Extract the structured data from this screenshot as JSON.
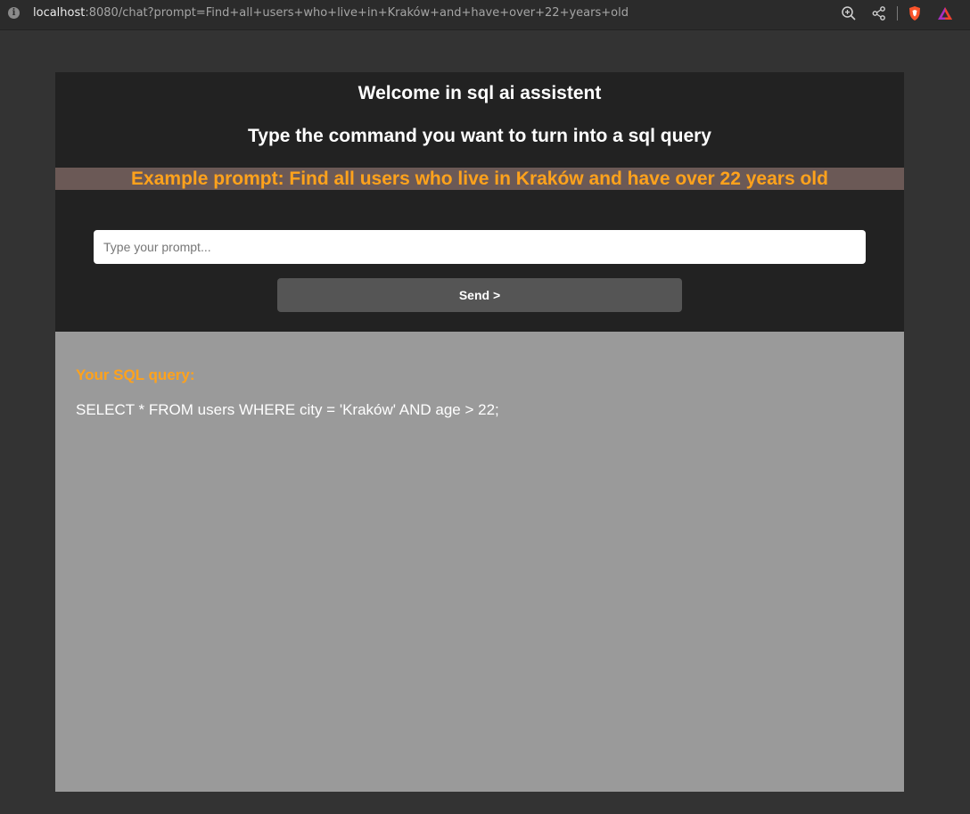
{
  "browser": {
    "url_host": "localhost",
    "url_rest": ":8080/chat?prompt=Find+all+users+who+live+in+Kraków+and+have+over+22+years+old",
    "icons": [
      "info-icon",
      "zoom-icon",
      "share-icon",
      "brave-shield-icon",
      "brave-rewards-icon"
    ]
  },
  "header": {
    "welcome": "Welcome in sql ai assistent",
    "subtitle": "Type the command you want to turn into a sql query",
    "example": "Example prompt: Find all users who live in Kraków and have over 22 years old"
  },
  "form": {
    "input_value": "",
    "input_placeholder": "Type your prompt...",
    "send_label": "Send >"
  },
  "result": {
    "label": "Your SQL query:",
    "query": "SELECT * FROM users WHERE city = 'Kraków' AND age > 22;"
  },
  "colors": {
    "accent": "#ffa21c",
    "panel": "#222222",
    "result_bg": "#9a9a9a",
    "page_bg": "#333333",
    "example_bg": "#6b5956"
  }
}
